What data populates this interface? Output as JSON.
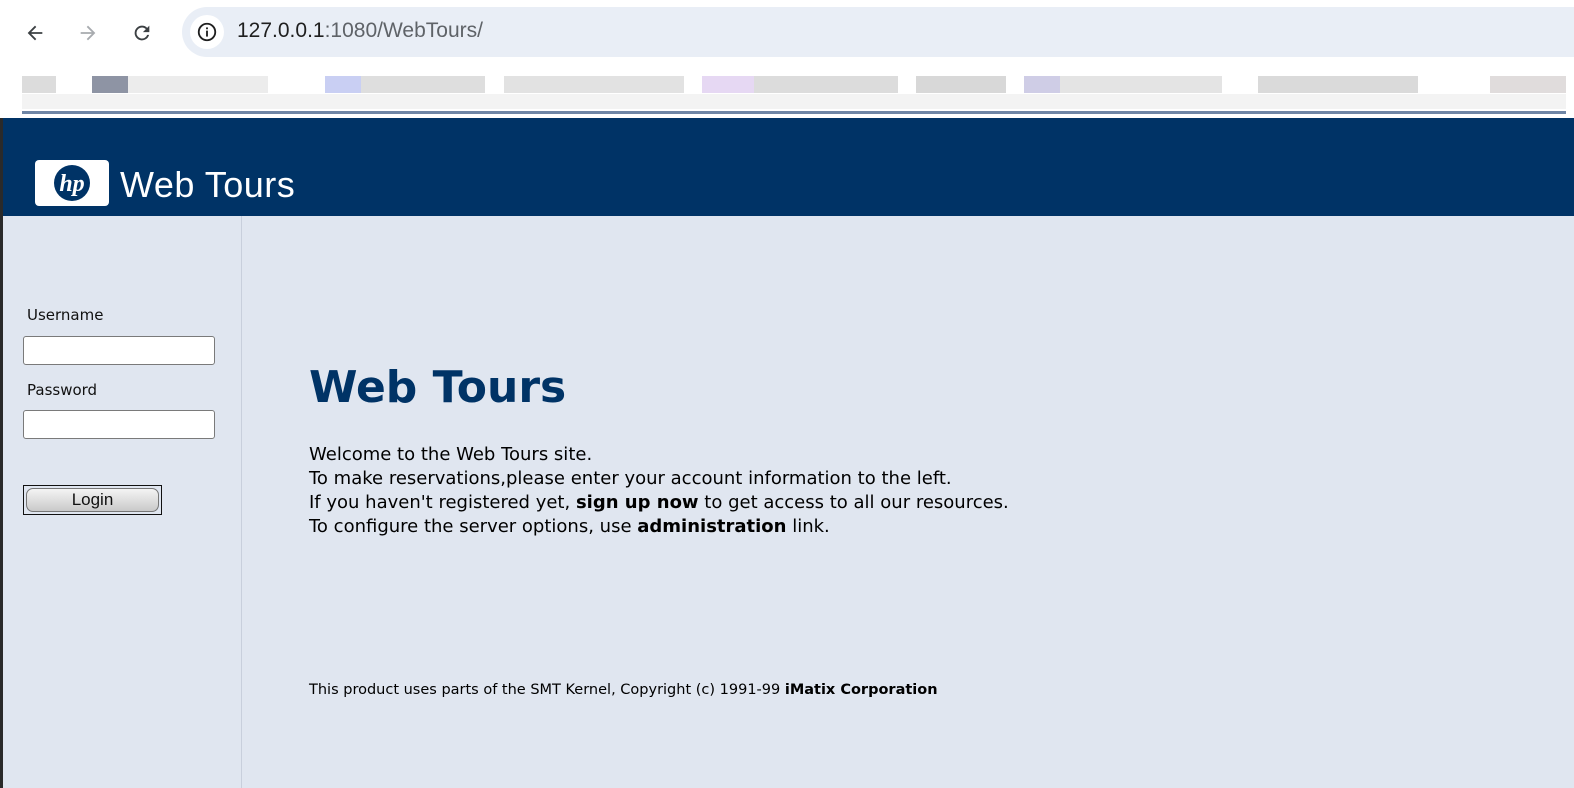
{
  "browser": {
    "url_host": "127.0.0.1",
    "url_rest": ":1080/WebTours/",
    "back_icon": "back-arrow-icon",
    "forward_icon": "forward-arrow-icon",
    "reload_icon": "reload-icon",
    "info_icon": "info-icon"
  },
  "header": {
    "logo_mark": "hp",
    "logo_text": "Web Tours",
    "bg_color": "#003366"
  },
  "login": {
    "username_label": "Username",
    "username_value": "",
    "password_label": "Password",
    "password_value": "",
    "button_label": "Login"
  },
  "main": {
    "title": "Web Tours",
    "line1": "Welcome to the Web Tours site.",
    "line2": "To make reservations,please enter your account information to the left.",
    "line3_pre": "If you haven't registered yet, ",
    "line3_link": "sign up now",
    "line3_post": " to get access to all our resources.",
    "line4_pre": "To configure the server options, use ",
    "line4_link": "administration",
    "line4_post": " link.",
    "footer_text": "This product uses parts of the SMT Kernel, Copyright (c) 1991-99 ",
    "footer_link": "iMatix Corporation"
  },
  "colors": {
    "accent": "#003366",
    "panel_bg": "#e0e6f0"
  }
}
